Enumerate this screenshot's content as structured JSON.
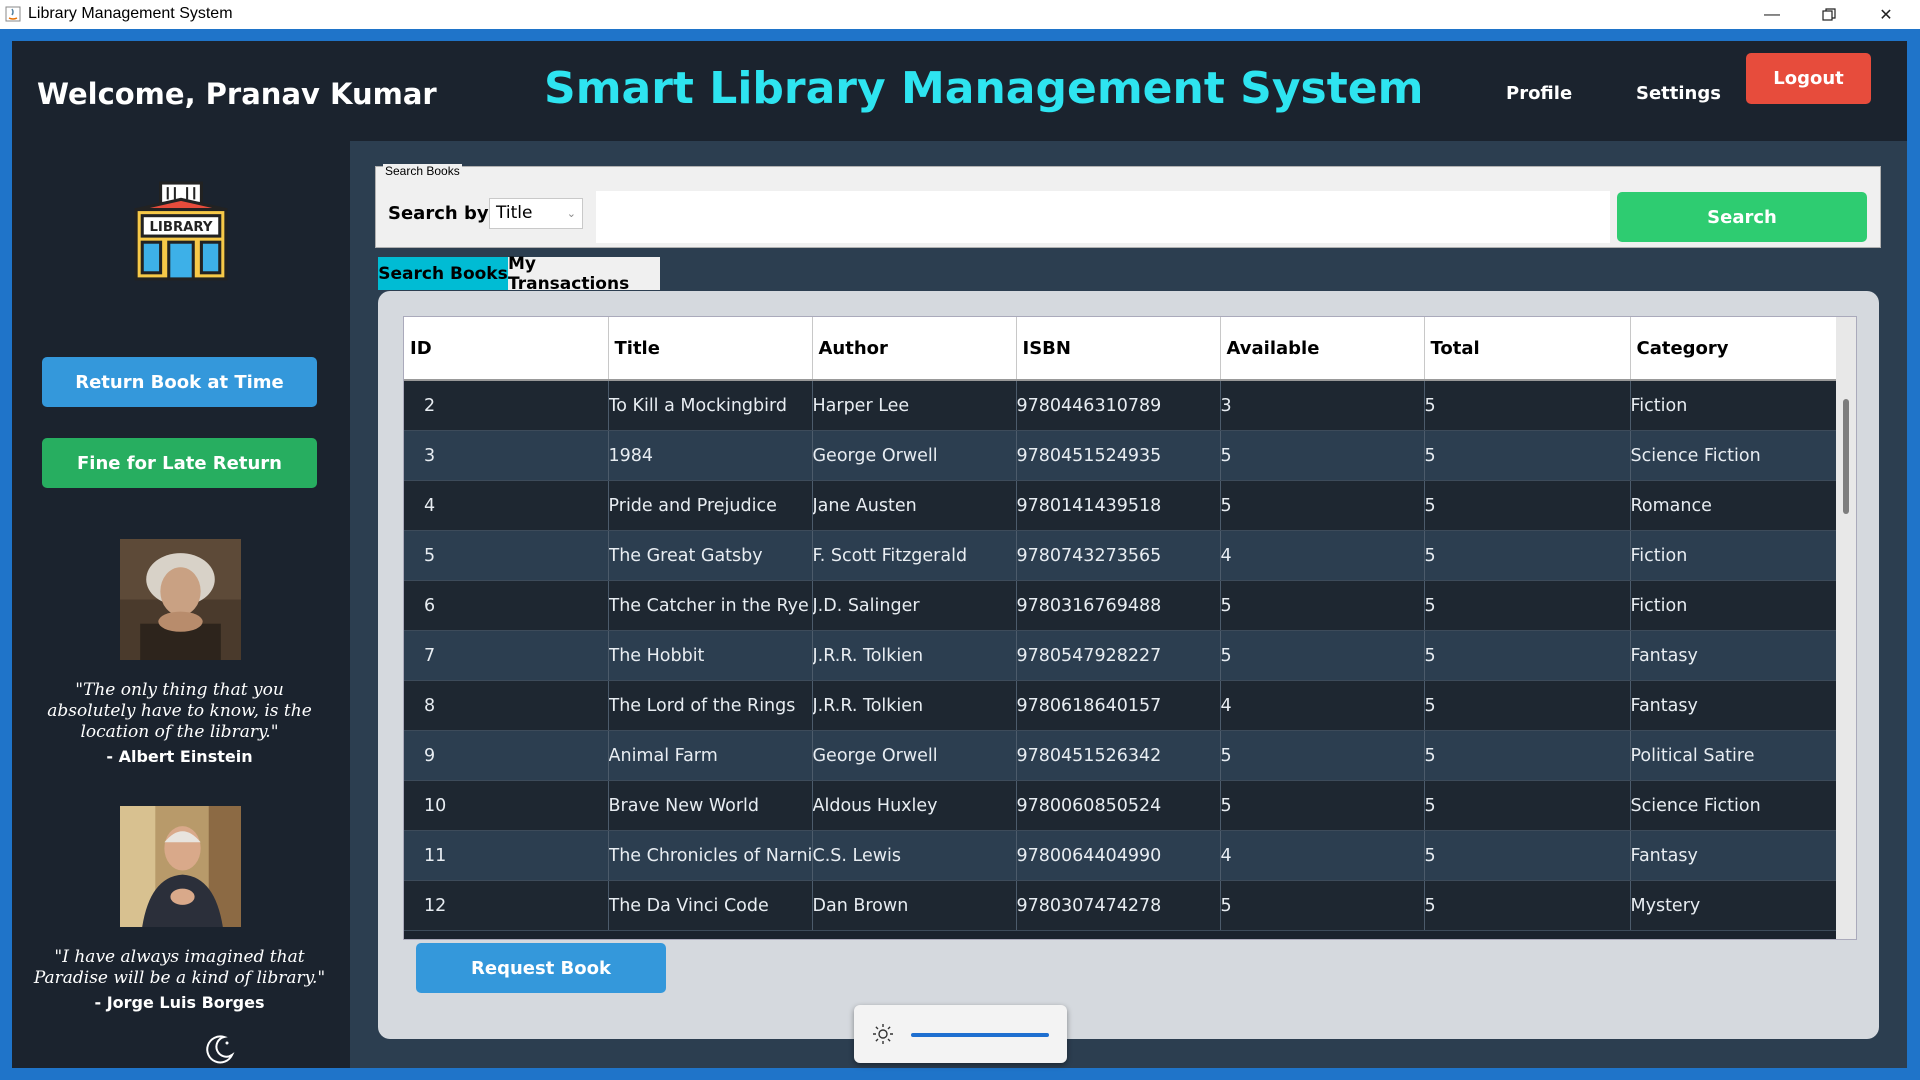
{
  "window": {
    "title": "Library Management System"
  },
  "header": {
    "welcome": "Welcome, Pranav Kumar",
    "app_title": "Smart Library Management System",
    "nav": {
      "profile": "Profile",
      "settings": "Settings",
      "logout": "Logout"
    }
  },
  "sidebar": {
    "return_button": "Return Book at Time",
    "fine_button": "Fine for Late Return",
    "quotes": [
      {
        "text": "\"The only thing that you absolutely have to know, is the location of the library.\"",
        "author": "- Albert Einstein"
      },
      {
        "text": "\"I have always imagined that Paradise will be a kind of library.\"",
        "author": "- Jorge Luis Borges"
      }
    ],
    "logo_text": "LIBRARY"
  },
  "search": {
    "group_label": "Search Books",
    "search_by_label": "Search by:",
    "field_selected": "Title",
    "query_value": "",
    "button": "Search"
  },
  "tabs": [
    {
      "label": "Search Books",
      "active": true
    },
    {
      "label": "My Transactions",
      "active": false
    }
  ],
  "table": {
    "columns": [
      "ID",
      "Title",
      "Author",
      "ISBN",
      "Available",
      "Total",
      "Category"
    ],
    "rows": [
      [
        "2",
        "To Kill a Mockingbird",
        "Harper Lee",
        "9780446310789",
        "3",
        "5",
        "Fiction"
      ],
      [
        "3",
        "1984",
        "George Orwell",
        "9780451524935",
        "5",
        "5",
        "Science Fiction"
      ],
      [
        "4",
        "Pride and Prejudice",
        "Jane Austen",
        "9780141439518",
        "5",
        "5",
        "Romance"
      ],
      [
        "5",
        "The Great Gatsby",
        "F. Scott Fitzgerald",
        "9780743273565",
        "4",
        "5",
        "Fiction"
      ],
      [
        "6",
        "The Catcher in the Rye",
        "J.D. Salinger",
        "9780316769488",
        "5",
        "5",
        "Fiction"
      ],
      [
        "7",
        "The Hobbit",
        "J.R.R. Tolkien",
        "9780547928227",
        "5",
        "5",
        "Fantasy"
      ],
      [
        "8",
        "The Lord of the Rings",
        "J.R.R. Tolkien",
        "9780618640157",
        "4",
        "5",
        "Fantasy"
      ],
      [
        "9",
        "Animal Farm",
        "George Orwell",
        "9780451526342",
        "5",
        "5",
        "Political Satire"
      ],
      [
        "10",
        "Brave New World",
        "Aldous Huxley",
        "9780060850524",
        "5",
        "5",
        "Science Fiction"
      ],
      [
        "11",
        "The Chronicles of Narnia",
        "C.S. Lewis",
        "9780064404990",
        "4",
        "5",
        "Fantasy"
      ],
      [
        "12",
        "The Da Vinci Code",
        "Dan Brown",
        "9780307474278",
        "5",
        "5",
        "Mystery"
      ]
    ]
  },
  "request_button": "Request Book",
  "brightness_level": 1.0,
  "colors": {
    "background": "#1b232e",
    "accent_title": "#2ee4f0",
    "logout": "#e74c3c",
    "primary_blue": "#3498db",
    "success_green": "#2ecc71",
    "active_tab": "#00bcd4"
  }
}
